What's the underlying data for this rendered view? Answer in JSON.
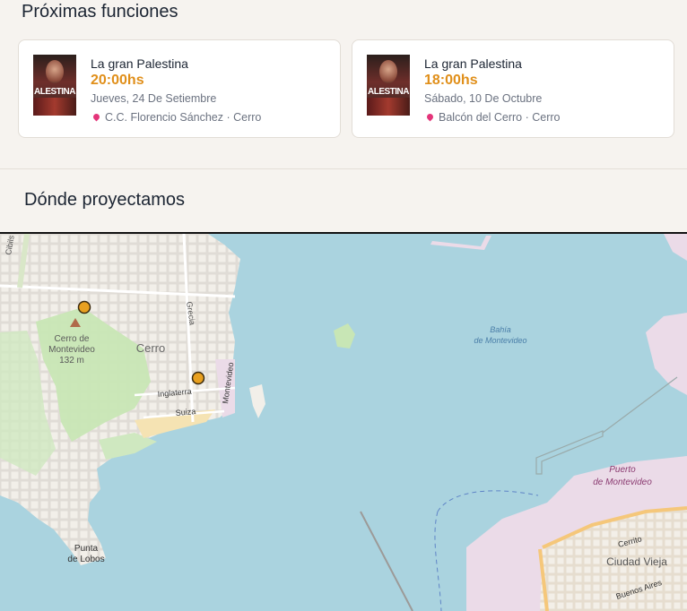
{
  "sections": {
    "upcoming_title": "Próximas funciones",
    "where_title": "Dónde proyectamos"
  },
  "cards": [
    {
      "poster_text": "ALESTINA",
      "title": "La gran Palestina",
      "time": "20:00hs",
      "date": "Jueves, 24 De Setiembre",
      "place": "C.C. Florencio Sánchez · Cerro"
    },
    {
      "poster_text": "ALESTINA",
      "title": "La gran Palestina",
      "time": "18:00hs",
      "date": "Sábado, 10 De Octubre",
      "place": "Balcón del Cerro · Cerro"
    }
  ],
  "map": {
    "labels": {
      "cibils": "Cibils",
      "grecia": "Grecia",
      "cerro_hill": "Cerro de",
      "cerro_hill2": "Montevideo",
      "elevation": "132 m",
      "cerro": "Cerro",
      "inglaterra": "Inglaterra",
      "suiza": "Suiza",
      "montevideo_street": "Montevideo",
      "bahia1": "Bahía",
      "bahia2": "de Montevideo",
      "puerto1": "Puerto",
      "puerto2": "de Montevideo",
      "punta1": "Punta",
      "punta2": "de Lobos",
      "cerrito": "Cerrito",
      "ciudad_vieja": "Ciudad Vieja",
      "buenos_aires": "Buenos Aires"
    },
    "colors": {
      "water": "#aad3df",
      "land": "#f2efe9",
      "park": "#c8e6b5",
      "marker": "#e8a020",
      "industrial": "#ebdbe8"
    }
  }
}
